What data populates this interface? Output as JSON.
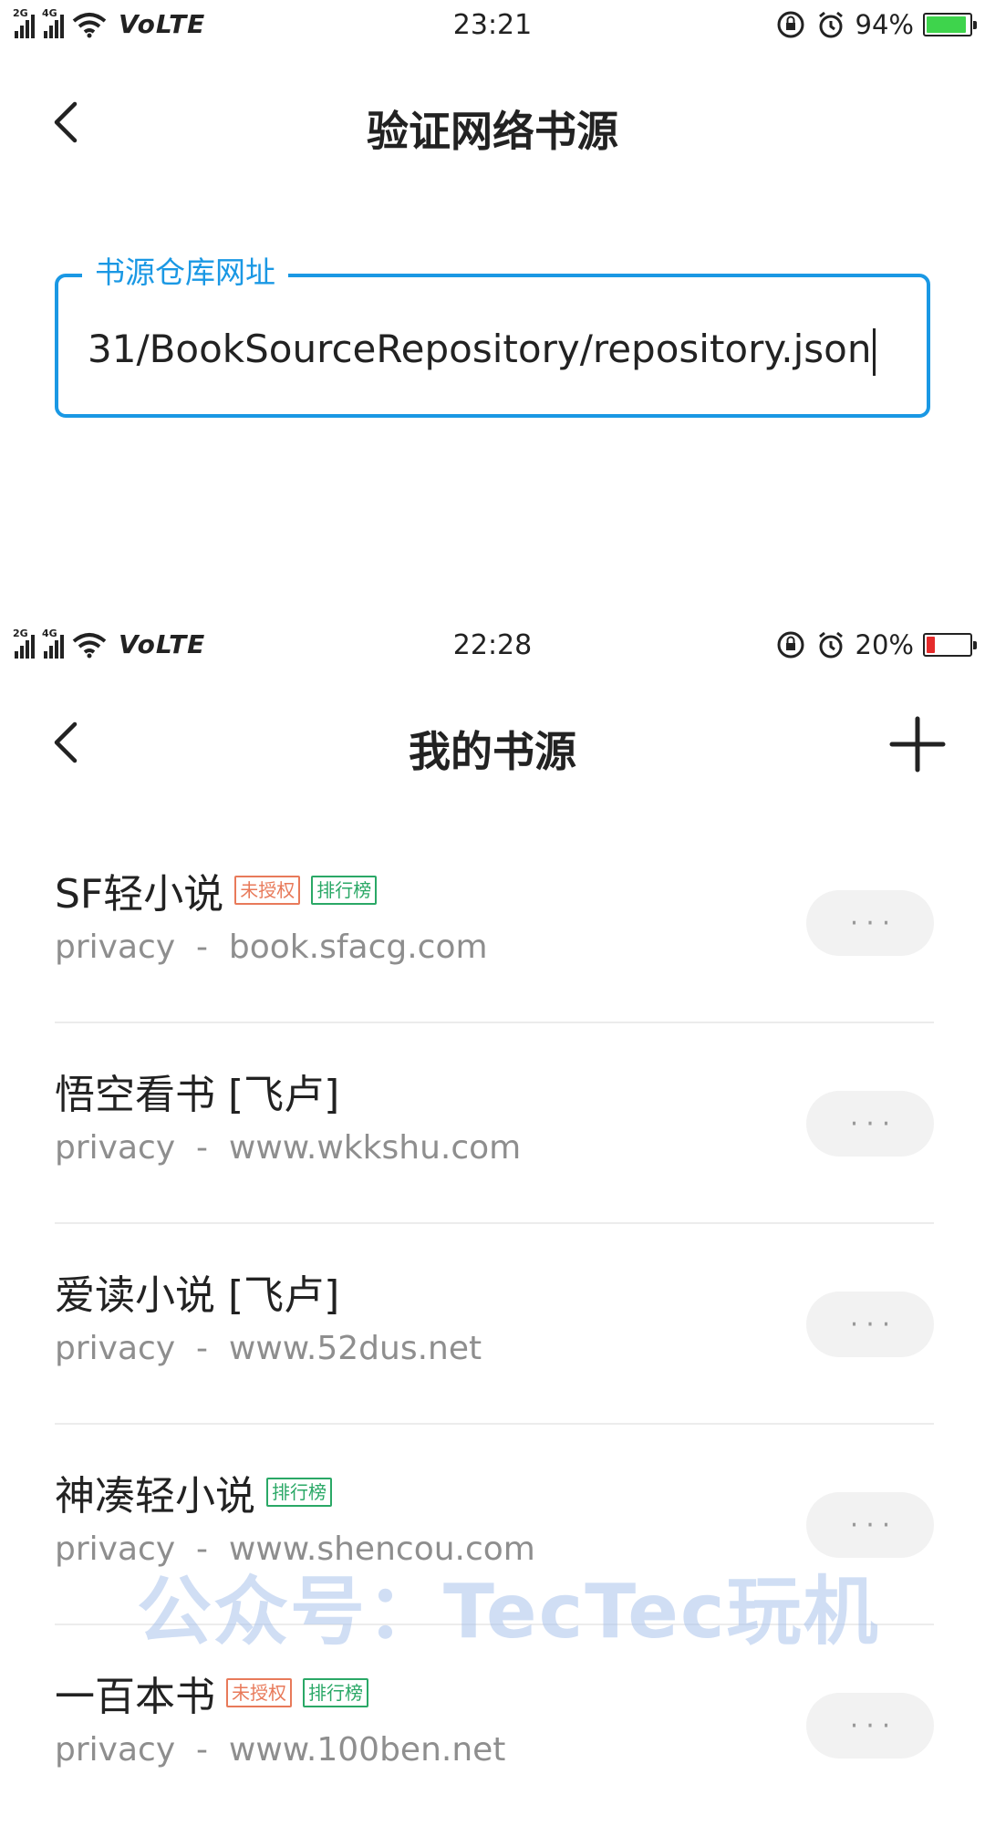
{
  "screen_top": {
    "status": {
      "time": "23:21",
      "battery_pct": "94%",
      "battery_level": 0.94,
      "battery_color": "#3ed44c",
      "volte": "VoLTE",
      "sim1": "2G",
      "sim2": "4G"
    },
    "title": "验证网络书源",
    "url_field": {
      "label": "书源仓库网址",
      "value": "31/BookSourceRepository/repository.json"
    }
  },
  "screen_bottom": {
    "status": {
      "time": "22:28",
      "battery_pct": "20%",
      "battery_level": 0.2,
      "battery_color": "#e52b2b",
      "volte": "VoLTE",
      "sim1": "2G",
      "sim2": "4G"
    },
    "title": "我的书源",
    "sources": [
      {
        "name": "SF轻小说",
        "badges": [
          "未授权",
          "排行榜"
        ],
        "privacy": "privacy",
        "domain": "book.sfacg.com"
      },
      {
        "name": "悟空看书 [飞卢]",
        "badges": [],
        "privacy": "privacy",
        "domain": "www.wkkshu.com"
      },
      {
        "name": "爱读小说 [飞卢]",
        "badges": [],
        "privacy": "privacy",
        "domain": "www.52dus.net"
      },
      {
        "name": "神凑轻小说",
        "badges": [
          "排行榜"
        ],
        "privacy": "privacy",
        "domain": "www.shencou.com"
      },
      {
        "name": "一百本书",
        "badges": [
          "未授权",
          "排行榜"
        ],
        "privacy": "privacy",
        "domain": "www.100ben.net"
      }
    ],
    "more_label": "···"
  },
  "watermark": "公众号：TecTec玩机",
  "colors": {
    "accent": "#1a98e4",
    "badge_unauth": "#e87a5a",
    "badge_rank": "#2aa866"
  }
}
